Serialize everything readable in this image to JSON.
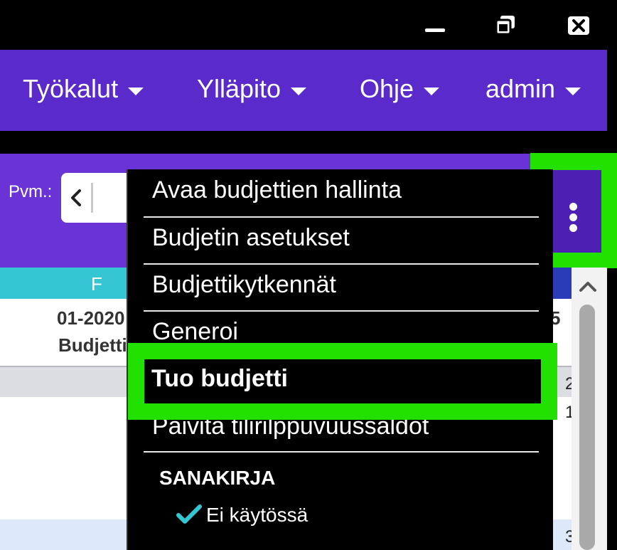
{
  "titlebar": {
    "minimize_icon": "minimize-icon",
    "restore_icon": "restore-icon",
    "close_icon": "close-icon"
  },
  "nav": {
    "items": [
      {
        "label": "Työkalut"
      },
      {
        "label": "Ylläpito"
      },
      {
        "label": "Ohje"
      },
      {
        "label": "admin"
      }
    ]
  },
  "toolbar": {
    "date_label": "Pvm.:",
    "more_icon": "kebab-menu-icon"
  },
  "table": {
    "column_header": "F",
    "row_date": "01-2020",
    "row_type": "Budjetti",
    "right_col_top": "5",
    "right_col_bottom": ".",
    "numbers": [
      "2",
      "1",
      "3"
    ]
  },
  "menu": {
    "items": [
      {
        "label": "Avaa budjettien hallinta"
      },
      {
        "label": "Budjetin asetukset"
      },
      {
        "label": "Budjettikytkennät"
      },
      {
        "label": "Generoi"
      },
      {
        "label": "Tuo budjetti"
      },
      {
        "label": "Päivitä tilirilppuvuussaldot"
      }
    ],
    "section_title": "SANAKIRJA",
    "checked_option": "Ei käytössä"
  },
  "colors": {
    "nav_bg": "#5b2acb",
    "toolbar_bg": "#6a33d6",
    "highlight": "#22e000",
    "column_header": "#34c7d3",
    "check": "#34c7d3"
  }
}
